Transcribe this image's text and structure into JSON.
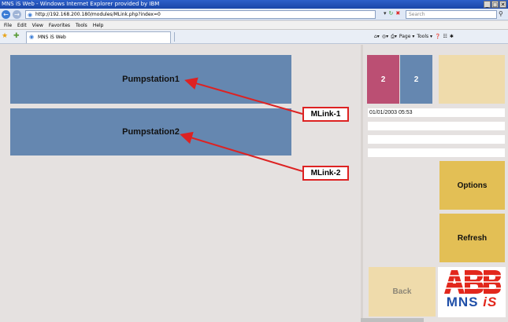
{
  "window": {
    "title": "MNS iS Web - Windows Internet Explorer provided by IBM",
    "controls": [
      "_",
      "□",
      "✕"
    ]
  },
  "addressbar": {
    "url": "http://192.168.200.180/modules/MLink.php?index=0",
    "search_placeholder": "Search"
  },
  "menu": [
    "File",
    "Edit",
    "View",
    "Favorites",
    "Tools",
    "Help"
  ],
  "tab": {
    "title": "MNS iS Web"
  },
  "commandbar": [
    "Page ▾",
    "Tools ▾"
  ],
  "stations": [
    {
      "name": "Pumpstation1"
    },
    {
      "name": "Pumpstation2"
    }
  ],
  "callouts": [
    "MLink-1",
    "MLink-2"
  ],
  "status": {
    "alarm_count": "2",
    "info_count": "2",
    "datetime": "01/01/2003 05:53"
  },
  "buttons": {
    "options": "Options",
    "refresh": "Refresh",
    "back": "Back"
  },
  "logo": {
    "brand": "ABB",
    "product_prefix": "MNS ",
    "product_suffix": "iS"
  },
  "colors": {
    "station_blue": "#6587b0",
    "alarm_red": "#bb4f73",
    "button_gold": "#e3bf55",
    "button_tan": "#efdbab",
    "callout_red": "#dd2222"
  }
}
